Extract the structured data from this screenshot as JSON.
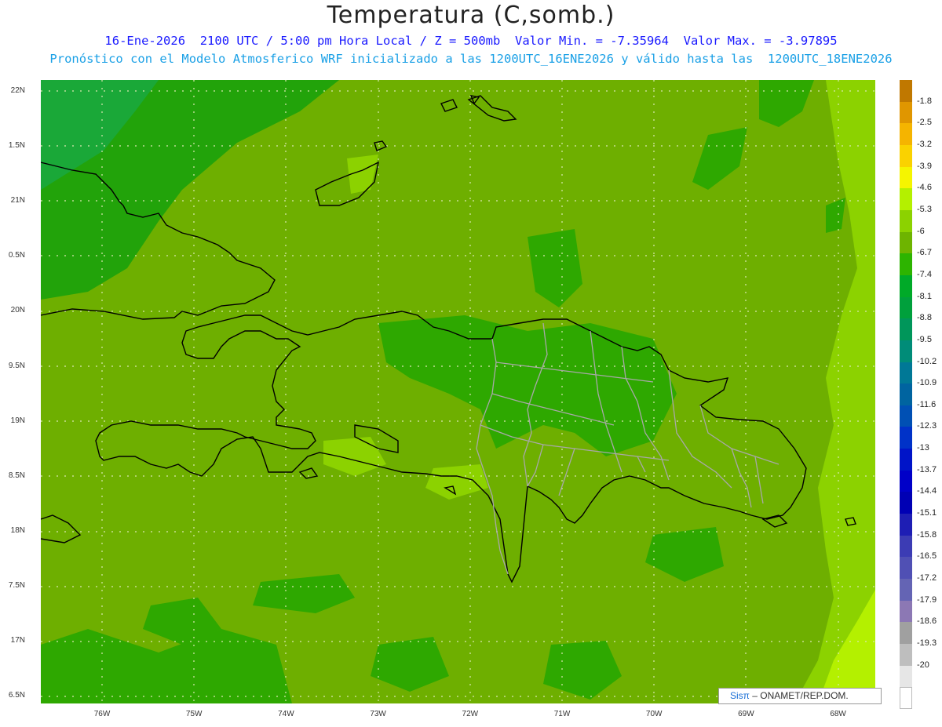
{
  "title": "Temperatura (C,somb.)",
  "subtitle1": "16-Ene-2026  2100 UTC / 5:00 pm Hora Local / Z = 500mb  Valor Min. = -7.35964  Valor Max. = -3.97895",
  "subtitle2": "Pronóstico con el Modelo Atmosferico WRF inicializado a las 1200UTC_16ENE2026 y válido hasta las  1200UTC_18ENE2026",
  "logo": {
    "sis": "Sisπ",
    "rest": " – ONAMET/REP.DOM."
  },
  "axes": {
    "lat_labels": [
      "22N",
      "1.5N",
      "21N",
      "0.5N",
      "20N",
      "9.5N",
      "19N",
      "8.5N",
      "18N",
      "7.5N",
      "17N",
      "6.5N"
    ],
    "lon_labels": [
      "76W",
      "75W",
      "74W",
      "73W",
      "72W",
      "71W",
      "70W",
      "69W",
      "68W"
    ]
  },
  "legend": {
    "labels": [
      "-1.8",
      "-2.5",
      "-3.2",
      "-3.9",
      "-4.6",
      "-5.3",
      "-6",
      "-6.7",
      "-7.4",
      "-8.1",
      "-8.8",
      "-9.5",
      "-10.2",
      "-10.9",
      "-11.6",
      "-12.3",
      "-13",
      "-13.7",
      "-14.4",
      "-15.1",
      "-15.8",
      "-16.5",
      "-17.2",
      "-17.9",
      "-18.6",
      "-19.3",
      "-20"
    ],
    "colors": [
      "#c07800",
      "#e09600",
      "#f5b400",
      "#fad200",
      "#f5f500",
      "#b4f000",
      "#8cd200",
      "#6eb400",
      "#2db400",
      "#00aa28",
      "#00a03c",
      "#00965a",
      "#008c78",
      "#007896",
      "#0064a0",
      "#0050b4",
      "#0032c8",
      "#0014c8",
      "#0000c8",
      "#0000b4",
      "#1e1eb4",
      "#3c3cb4",
      "#5050b4",
      "#6464b4",
      "#8c78b4",
      "#a0a0a0",
      "#bebebe",
      "#e6e6e6",
      "#ffffff"
    ]
  },
  "map": {
    "background_color": "#6eaf00",
    "darker_color": "#2db400",
    "lighter_color": "#8cd200",
    "lightest_color": "#b4f000",
    "coast_color": "#000000",
    "border_color": "#a8a8a8",
    "grid_color": "#d9e8b0"
  }
}
